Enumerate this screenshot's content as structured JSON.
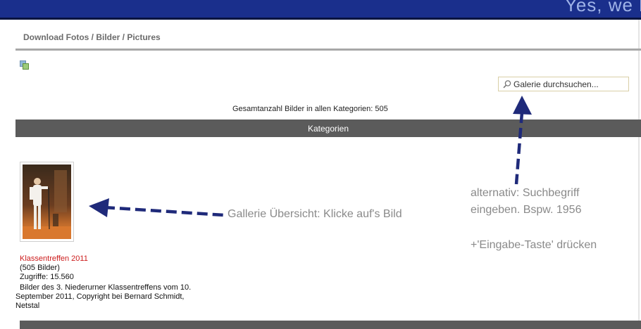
{
  "header": {
    "slogan": "Yes, we l"
  },
  "page": {
    "title": "Download Fotos / Bilder / Pictures"
  },
  "toolbar": {
    "slideshow_icon": "slideshow-icon"
  },
  "search": {
    "placeholder": "Galerie durchsuchen..."
  },
  "gallery": {
    "total_count_text": "Gesamtanzahl Bilder in allen Kategorien: 505",
    "section_label": "Kategorien",
    "categories": [
      {
        "name": "Klassentreffen 2011",
        "count_text": "(505 Bilder)",
        "views_text": "Zugriffe: 15.560",
        "description_line1": "Bilder des 3. Niederurner Klassentreffens vom 10.",
        "description_line2": "September 2011, Copyright bei Bernard Schmidt,",
        "description_line3": "Netstal"
      }
    ]
  },
  "annotations": {
    "gallery_hint": "Gallerie Übersicht: Klicke auf's Bild",
    "search_hint_line1": "alternativ: Suchbegriff",
    "search_hint_line2": "eingeben. Bspw. 1956",
    "search_hint_line3": "+'Eingabe-Taste' drücken",
    "arrow_color": "#1f2a7a"
  },
  "colors": {
    "header_bg": "#1a2f8c",
    "category_bar_bg": "#5b5b5b",
    "category_name": "#cc1c1c"
  }
}
